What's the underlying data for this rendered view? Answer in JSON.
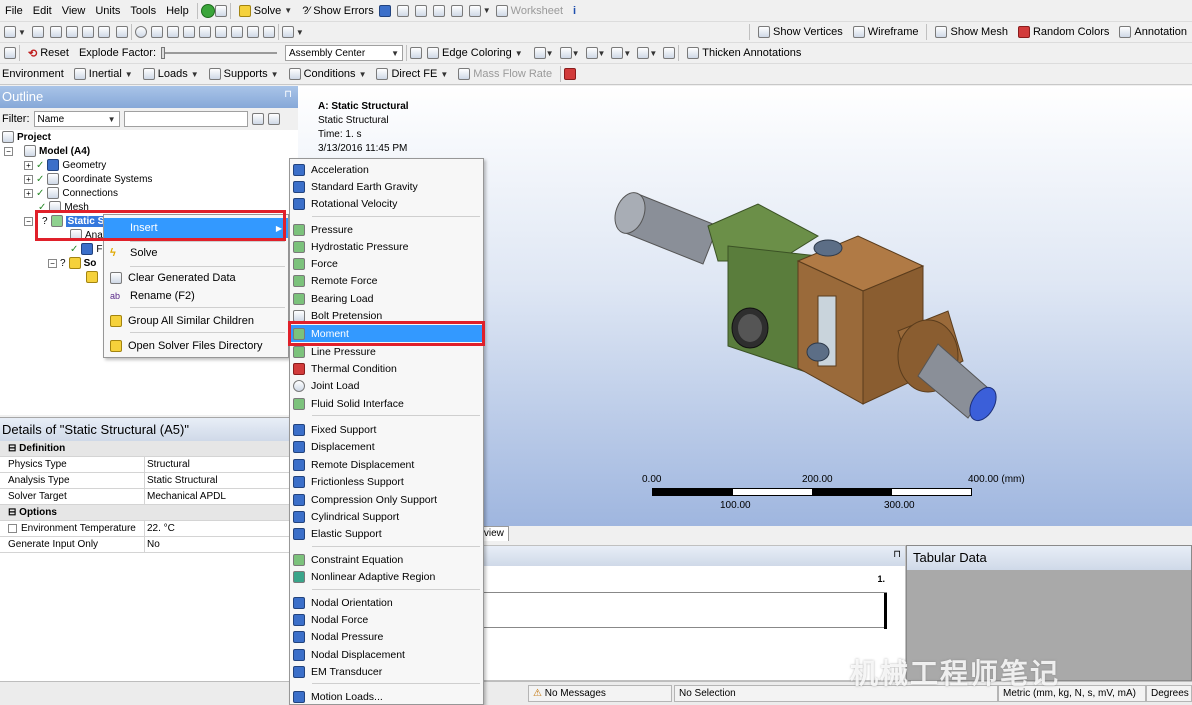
{
  "menubar": {
    "items": [
      "File",
      "Edit",
      "View",
      "Units",
      "Tools",
      "Help"
    ]
  },
  "toolbar1": {
    "solve_label": "Solve",
    "show_errors_label": "?⁄ Show Errors",
    "worksheet_label": "Worksheet"
  },
  "toolbar2": {
    "show_vertices": "Show Vertices",
    "wireframe": "Wireframe",
    "show_mesh": "Show Mesh",
    "random_colors": "Random Colors",
    "annotation": "Annotation"
  },
  "toolbar3": {
    "reset_label": "Reset",
    "explode_factor_label": "Explode Factor:",
    "assembly_center": "Assembly Center",
    "edge_coloring": "Edge Coloring",
    "thicken_annotations": "Thicken Annotations"
  },
  "toolbar4": {
    "environment": "Environment",
    "inertial": "Inertial",
    "loads": "Loads",
    "supports": "Supports",
    "conditions": "Conditions",
    "direct_fe": "Direct FE",
    "mass_flow_rate": "Mass Flow Rate"
  },
  "outline": {
    "title": "Outline",
    "filter_label": "Filter:",
    "filter_value": "Name",
    "tree": {
      "project": "Project",
      "model": "Model (A4)",
      "geometry": "Geometry",
      "coordinate_systems": "Coordinate Systems",
      "connections": "Connections",
      "mesh": "Mesh",
      "static_structural": "Static S",
      "analysis": "Ana",
      "fixed": "Fix",
      "solution": "So"
    }
  },
  "context_menu": {
    "items": [
      "Insert",
      "Solve",
      "Clear Generated Data",
      "Rename (F2)",
      "Group All Similar Children",
      "Open Solver Files Directory"
    ]
  },
  "insert_submenu": {
    "items": [
      "Acceleration",
      "Standard Earth Gravity",
      "Rotational Velocity",
      "Pressure",
      "Hydrostatic Pressure",
      "Force",
      "Remote Force",
      "Bearing Load",
      "Bolt Pretension",
      "Moment",
      "Line Pressure",
      "Thermal Condition",
      "Joint Load",
      "Fluid Solid Interface",
      "Fixed Support",
      "Displacement",
      "Remote Displacement",
      "Frictionless Support",
      "Compression Only Support",
      "Cylindrical Support",
      "Elastic Support",
      "Constraint Equation",
      "Nonlinear Adaptive Region",
      "Nodal Orientation",
      "Nodal Force",
      "Nodal Pressure",
      "Nodal Displacement",
      "EM Transducer",
      "Motion Loads..."
    ],
    "highlighted": "Moment"
  },
  "viewport": {
    "title": "A: Static Structural",
    "subtitle": "Static Structural",
    "time": "Time: 1. s",
    "date": "3/13/2016 11:45 PM",
    "scale_top": [
      "0.00",
      "200.00",
      "400.00 (mm)"
    ],
    "scale_bottom": [
      "100.00",
      "300.00"
    ],
    "preview_tab": "review"
  },
  "details": {
    "title": "Details of \"Static Structural (A5)\"",
    "sections": [
      {
        "name": "Definition",
        "rows": [
          [
            "Physics Type",
            "Structural"
          ],
          [
            "Analysis Type",
            "Static Structural"
          ],
          [
            "Solver Target",
            "Mechanical APDL"
          ]
        ]
      },
      {
        "name": "Options",
        "rows": [
          [
            "Environment Temperature",
            "22. °C"
          ],
          [
            "Generate Input Only",
            "No"
          ]
        ]
      }
    ]
  },
  "graph": {
    "label_one": "1."
  },
  "tabular": {
    "title": "Tabular Data"
  },
  "status": {
    "messages": "No Messages",
    "selection": "No Selection",
    "units": "Metric (mm, kg, N, s, mV, mA)",
    "angle": "Degrees"
  },
  "watermark": {
    "text": "机械工程师笔记"
  },
  "colors": {
    "highlight": "#3399ff",
    "callout": "#e0202a",
    "part_green": "#5a7d3c",
    "part_brown": "#9a6a3a",
    "shaft_gray": "#8a8f98"
  }
}
